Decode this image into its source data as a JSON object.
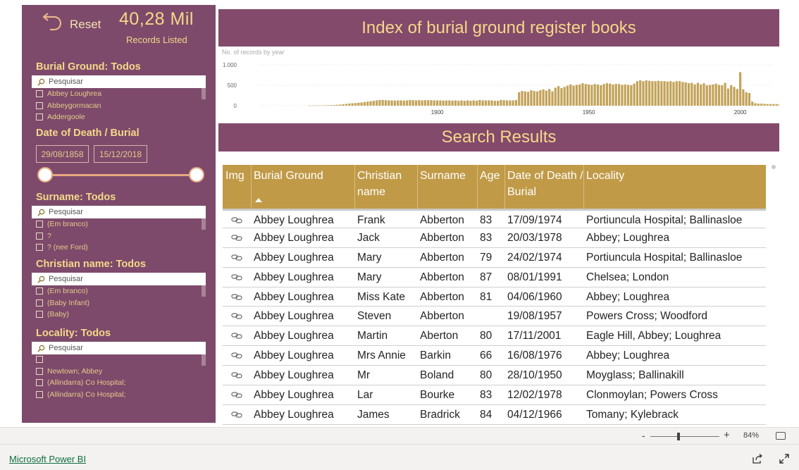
{
  "sidebar": {
    "reset_label": "Reset",
    "kpi_value": "40,28 Mil",
    "kpi_label": "Records Listed",
    "burial_ground": {
      "title": "Burial Ground: Todos",
      "search_placeholder": "Pesquisar",
      "items": [
        "Abbey Loughrea",
        "Abbeygormacan",
        "Addergoole"
      ]
    },
    "date": {
      "title": "Date of Death / Burial",
      "start": "29/08/1858",
      "end": "15/12/2018"
    },
    "surname": {
      "title": "Surname: Todos",
      "search_placeholder": "Pesquisar",
      "items": [
        "(Em branco)",
        "?",
        "? (nee Ford)"
      ]
    },
    "christian_name": {
      "title": "Christian name: Todos",
      "search_placeholder": "Pesquisar",
      "items": [
        "(Em branco)",
        "(Baby Infant)",
        "(Baby)"
      ]
    },
    "locality": {
      "title": "Locality: Todos",
      "search_placeholder": "Pesquisar",
      "items": [
        "",
        "Newtown; Abbey",
        "(Allindarra) Co Hospital;",
        "(Allindarra) Co Hospital;"
      ]
    }
  },
  "header": {
    "title": "Index of burial ground register books"
  },
  "results_header": {
    "title": "Search Results"
  },
  "chart_data": {
    "type": "bar",
    "title": "No. of records by year",
    "xlabel": "",
    "ylabel": "",
    "ylim": [
      0,
      1000
    ],
    "yticks": [
      "1.000",
      "500",
      "0"
    ],
    "xticks": [
      "1900",
      "1950",
      "2000"
    ],
    "x": [
      1858,
      1859,
      1860,
      1861,
      1862,
      1863,
      1864,
      1865,
      1866,
      1867,
      1868,
      1869,
      1870,
      1871,
      1872,
      1873,
      1874,
      1875,
      1876,
      1877,
      1878,
      1879,
      1880,
      1881,
      1882,
      1883,
      1884,
      1885,
      1886,
      1887,
      1888,
      1889,
      1890,
      1891,
      1892,
      1893,
      1894,
      1895,
      1896,
      1897,
      1898,
      1899,
      1900,
      1901,
      1902,
      1903,
      1904,
      1905,
      1906,
      1907,
      1908,
      1909,
      1910,
      1911,
      1912,
      1913,
      1914,
      1915,
      1916,
      1917,
      1918,
      1919,
      1920,
      1921,
      1922,
      1923,
      1924,
      1925,
      1926,
      1927,
      1928,
      1929,
      1930,
      1931,
      1932,
      1933,
      1934,
      1935,
      1936,
      1937,
      1938,
      1939,
      1940,
      1941,
      1942,
      1943,
      1944,
      1945,
      1946,
      1947,
      1948,
      1949,
      1950,
      1951,
      1952,
      1953,
      1954,
      1955,
      1956,
      1957,
      1958,
      1959,
      1960,
      1961,
      1962,
      1963,
      1964,
      1965,
      1966,
      1967,
      1968,
      1969,
      1970,
      1971,
      1972,
      1973,
      1974,
      1975,
      1976,
      1977,
      1978,
      1979,
      1980,
      1981,
      1982,
      1983,
      1984,
      1985,
      1986,
      1987,
      1988,
      1989,
      1990,
      1991,
      1992,
      1993,
      1994,
      1995,
      1996,
      1997,
      1998,
      1999,
      2000,
      2001,
      2002,
      2003,
      2004,
      2005,
      2006,
      2007,
      2008,
      2009,
      2010,
      2011,
      2012,
      2013,
      2014,
      2015,
      2016,
      2017,
      2018
    ],
    "values": [
      5,
      5,
      5,
      6,
      8,
      10,
      12,
      15,
      18,
      22,
      28,
      35,
      45,
      55,
      60,
      65,
      75,
      80,
      90,
      100,
      110,
      120,
      130,
      140,
      140,
      135,
      130,
      130,
      125,
      130,
      130,
      125,
      130,
      140,
      135,
      130,
      135,
      130,
      135,
      135,
      135,
      130,
      130,
      130,
      125,
      130,
      130,
      125,
      130,
      120,
      130,
      120,
      130,
      120,
      130,
      125,
      140,
      130,
      130,
      130,
      130,
      120,
      120,
      140,
      135,
      130,
      130,
      130,
      140,
      330,
      360,
      350,
      340,
      380,
      360,
      350,
      380,
      400,
      370,
      410,
      350,
      440,
      480,
      430,
      460,
      490,
      520,
      490,
      510,
      520,
      550,
      530,
      520,
      510,
      530,
      520,
      500,
      530,
      550,
      540,
      520,
      530,
      530,
      510,
      520,
      510,
      500,
      540,
      600,
      620,
      600,
      620,
      610,
      600,
      600,
      610,
      600,
      600,
      590,
      600,
      580,
      600,
      600,
      580,
      570,
      550,
      560,
      520,
      560,
      520,
      550,
      500,
      510,
      520,
      540,
      510,
      500,
      560,
      420,
      500,
      460,
      410,
      820,
      400,
      330,
      310,
      100,
      60,
      50,
      50,
      45,
      40,
      40,
      40,
      40,
      35,
      30,
      30,
      20,
      12
    ]
  },
  "table": {
    "headers": {
      "img": "Img",
      "burial_ground": "Burial Ground",
      "christian_name": "Christian name",
      "surname": "Surname",
      "age": "Age",
      "date": "Date of Death / Burial",
      "locality": "Locality"
    },
    "rows": [
      {
        "burial_ground": "Abbey Loughrea",
        "christian_name": "Frank",
        "surname": "Abberton",
        "age": "83",
        "date": "17/09/1974",
        "locality": "Portiuncula Hospital; Ballinasloe"
      },
      {
        "burial_ground": "Abbey Loughrea",
        "christian_name": "Jack",
        "surname": "Abberton",
        "age": "83",
        "date": "20/03/1978",
        "locality": "Abbey; Loughrea"
      },
      {
        "burial_ground": "Abbey Loughrea",
        "christian_name": "Mary",
        "surname": "Abberton",
        "age": "79",
        "date": "24/02/1974",
        "locality": "Portiuncula Hospital; Ballinasloe"
      },
      {
        "burial_ground": "Abbey Loughrea",
        "christian_name": "Mary",
        "surname": "Abberton",
        "age": "87",
        "date": "08/01/1991",
        "locality": "Chelsea; London"
      },
      {
        "burial_ground": "Abbey Loughrea",
        "christian_name": "Miss Kate",
        "surname": "Abberton",
        "age": "81",
        "date": "04/06/1960",
        "locality": "Abbey; Loughrea"
      },
      {
        "burial_ground": "Abbey Loughrea",
        "christian_name": "Steven",
        "surname": "Abberton",
        "age": "",
        "date": "19/08/1957",
        "locality": "Powers Cross; Woodford"
      },
      {
        "burial_ground": "Abbey Loughrea",
        "christian_name": "Martin",
        "surname": "Aberton",
        "age": "80",
        "date": "17/11/2001",
        "locality": "Eagle Hill, Abbey; Loughrea"
      },
      {
        "burial_ground": "Abbey Loughrea",
        "christian_name": "Mrs Annie",
        "surname": "Barkin",
        "age": "66",
        "date": "16/08/1976",
        "locality": "Abbey; Loughrea"
      },
      {
        "burial_ground": "Abbey Loughrea",
        "christian_name": "Mr",
        "surname": "Boland",
        "age": "80",
        "date": "28/10/1950",
        "locality": "Moyglass; Ballinakill"
      },
      {
        "burial_ground": "Abbey Loughrea",
        "christian_name": "Lar",
        "surname": "Bourke",
        "age": "83",
        "date": "12/02/1978",
        "locality": "Clonmoylan; Powers Cross"
      },
      {
        "burial_ground": "Abbey Loughrea",
        "christian_name": "James",
        "surname": "Bradrick",
        "age": "84",
        "date": "04/12/1966",
        "locality": "Tomany; Kylebrack"
      }
    ]
  },
  "zoom": {
    "minus": "-",
    "plus": "+",
    "level": "84%"
  },
  "footer": {
    "link": "Microsoft Power BI"
  },
  "colors": {
    "panel": "#7d4a6b",
    "accent": "#f5d889",
    "table_header": "#c09a47",
    "bar": "#c2a35a"
  }
}
